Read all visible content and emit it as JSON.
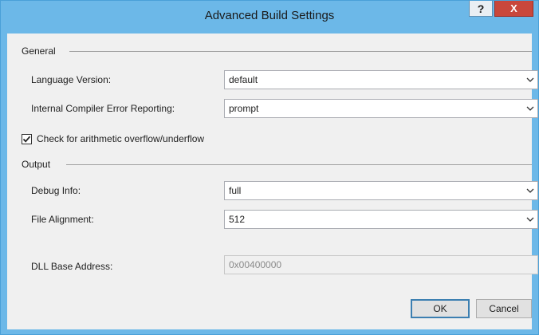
{
  "window": {
    "title": "Advanced Build Settings",
    "help_label": "?",
    "close_label": "X"
  },
  "general": {
    "group_label": "General",
    "language_version": {
      "label": "Language Version:",
      "value": "default"
    },
    "internal_compiler_error_reporting": {
      "label": "Internal Compiler Error Reporting:",
      "value": "prompt"
    },
    "check_overflow": {
      "label": "Check for arithmetic overflow/underflow",
      "checked": true
    }
  },
  "output": {
    "group_label": "Output",
    "debug_info": {
      "label": "Debug Info:",
      "value": "full"
    },
    "file_alignment": {
      "label": "File Alignment:",
      "value": "512"
    },
    "dll_base_address": {
      "label": "DLL Base Address:",
      "value": "0x00400000",
      "disabled": true
    }
  },
  "buttons": {
    "ok_label": "OK",
    "cancel_label": "Cancel"
  },
  "colors": {
    "titlebar": "#6cb8e8",
    "close_button": "#c9473b",
    "dialog_background": "#f0f0f0"
  },
  "icons": {
    "dropdown": "chevron-down-icon",
    "checkbox": "checkmark-icon"
  }
}
